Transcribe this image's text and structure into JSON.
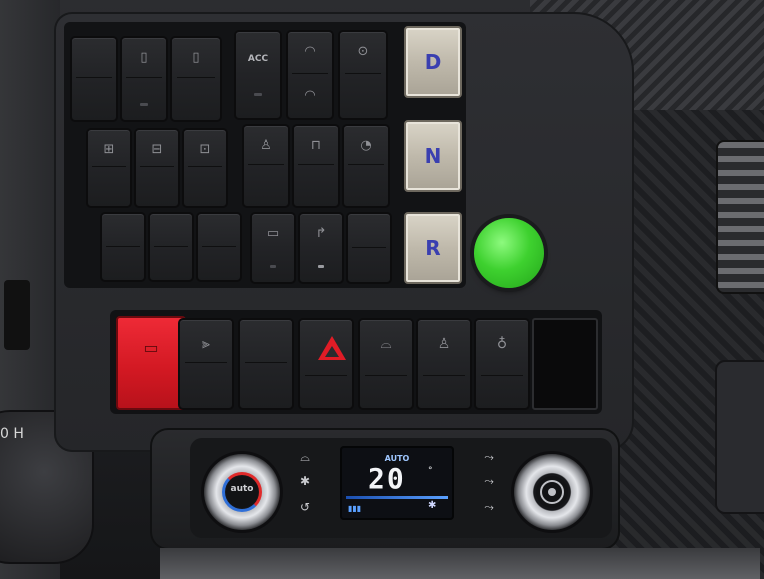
{
  "image": {
    "subject": "vehicle dashboard center console",
    "colors": {
      "red_switch": "#d11822",
      "hazard": "#e01c26",
      "green_button": "#3ed12f",
      "gear_label": "#3a3fb0",
      "display_bg": "#0d0f14"
    }
  },
  "upper_switches": {
    "acc_label": "ACC"
  },
  "gear_selector": {
    "drive": "D",
    "neutral": "N",
    "reverse": "R"
  },
  "left_knob": {
    "label": "0 H"
  },
  "climate": {
    "left_knob_label": "auto",
    "display": {
      "mode": "AUTO",
      "temperature": "20",
      "unit": "°"
    }
  }
}
